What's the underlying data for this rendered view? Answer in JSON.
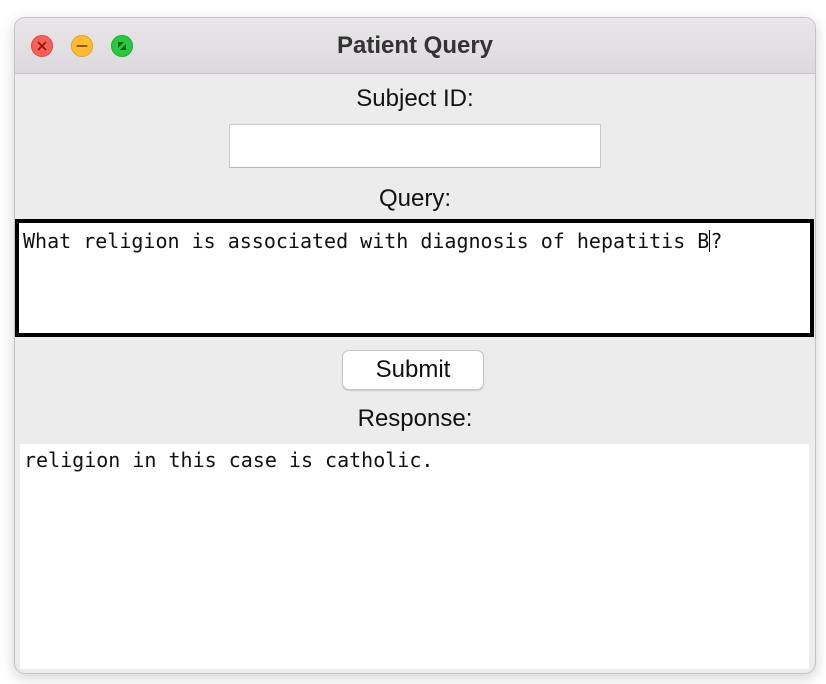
{
  "window": {
    "title": "Patient Query",
    "controls": {
      "close_icon": "close-icon",
      "minimize_icon": "minimize-icon",
      "zoom_icon": "fullscreen-icon",
      "close_color": "#ff5f57",
      "minimize_color": "#febc2e",
      "zoom_color": "#28c840"
    }
  },
  "form": {
    "subject_id_label": "Subject ID:",
    "subject_id_value": "",
    "query_label": "Query:",
    "query_text_before_caret": "What religion is associated with diagnosis of hepatitis B",
    "query_text_after_caret": "?",
    "submit_label": "Submit",
    "response_label": "Response:",
    "response_text": "religion in this case is catholic."
  }
}
